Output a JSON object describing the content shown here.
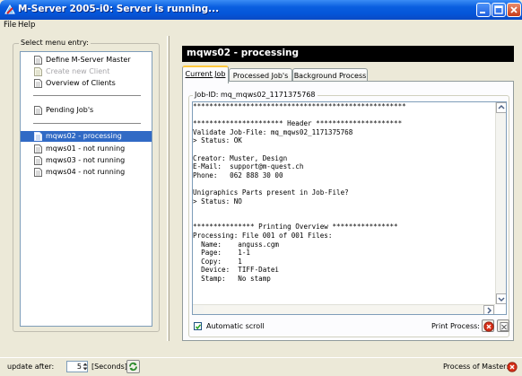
{
  "window": {
    "title": "M-Server 2005-i0: Server is running..."
  },
  "menu": [
    "File",
    "Help"
  ],
  "sidebar": {
    "legend": "Select menu entry:",
    "items": [
      {
        "label": "Define M-Server Master",
        "state": "normal"
      },
      {
        "label": "Create new Client",
        "state": "disabled"
      },
      {
        "label": "Overview of Clients",
        "state": "normal"
      },
      {
        "label": "Pending Job's",
        "state": "normal"
      },
      {
        "label": "mqws02 - processing",
        "state": "selected"
      },
      {
        "label": "mqws01 - not running",
        "state": "normal"
      },
      {
        "label": "mqws03 - not running",
        "state": "normal"
      },
      {
        "label": "mqws04 - not running",
        "state": "normal"
      }
    ]
  },
  "main": {
    "header": "mqws02 - processing",
    "tabs": [
      "Current Job",
      "Processed Job's",
      "Background Process"
    ],
    "active_tab": "Current Job",
    "job_legend": "Job-ID: mq_mqws02_1171375768",
    "log": "****************************************************\n\n********************** Header *********************\nValidate Job-File: mq_mqws02_1171375768\n> Status: OK\n\nCreator: Muster, Design\nE-Mail:  support@m-quest.ch\nPhone:   062 888 30 00\n\nUnigraphics Parts present in Job-File?\n> Status: NO\n\n\n*************** Printing Overview ****************\nProcessing: File 001 of 001 Files:\n  Name:    anguss.cgm\n  Page:    1-1\n  Copy:    1\n  Device:  TIFF-Datei\n  Stamp:   No stamp",
    "autoscroll": {
      "label": "Automatic scroll",
      "checked": true
    },
    "print_process_label": "Print Process:"
  },
  "status": {
    "update_label": "update after:",
    "update_value": "5",
    "unit_label": "[Seconds]",
    "master_label": "Process of Master:"
  },
  "colors": {
    "selection": "#316ac5",
    "title_blue": "#0455d8",
    "stop_red": "#d83018"
  }
}
